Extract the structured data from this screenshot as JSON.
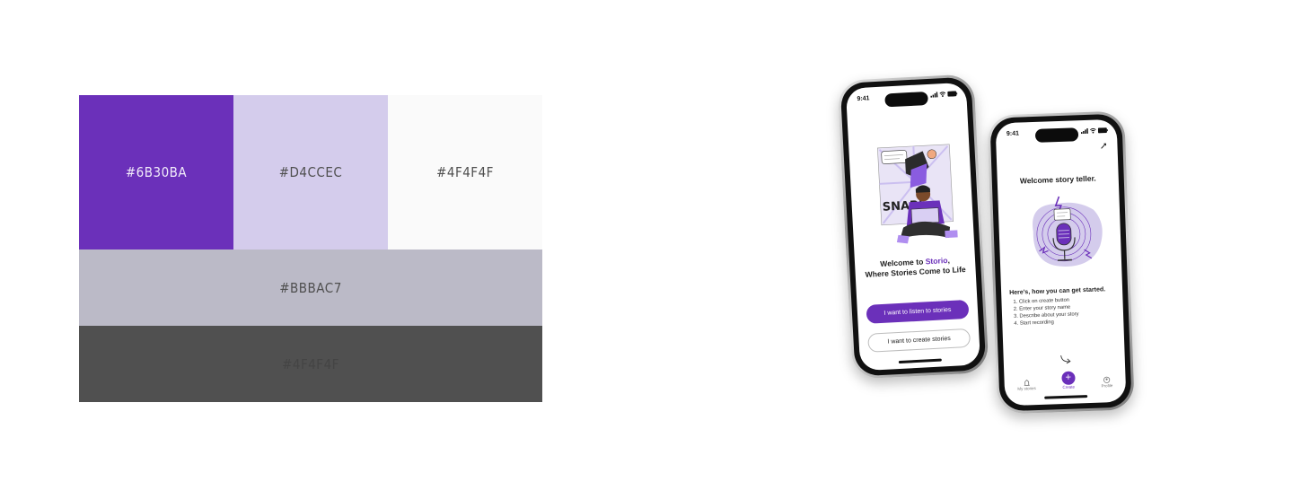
{
  "palette": {
    "swatches": [
      {
        "label": "#6B30BA",
        "color": "#6B30BA"
      },
      {
        "label": "#D4CCEC",
        "color": "#D4CCEC"
      },
      {
        "label": "#4F4F4F",
        "color": "#FAFAFA"
      },
      {
        "label": "#BBBAC7",
        "color": "#BBBAC7"
      },
      {
        "label": "#4F4F4F",
        "color": "#505050"
      }
    ]
  },
  "phone_welcome": {
    "time": "9:41",
    "welcome_prefix": "Welcome to ",
    "brand": "Storio",
    "welcome_suffix": ",",
    "welcome_line2": "Where Stories Come to Life",
    "listen_button": "I want to listen to stories",
    "create_button": "I want to create stories",
    "illustration_icon": "person-reading-comic-illustration",
    "accent_color": "#6B30BA"
  },
  "phone_create": {
    "time": "9:41",
    "title": "Welcome story teller.",
    "subtitle": "Here's, how you can get started.",
    "steps": [
      "1. Click on create button",
      "2. Enter your story name",
      "3. Describe about your story",
      "4. Start recording"
    ],
    "tabs": [
      {
        "label": "My stories",
        "icon": "stories-icon"
      },
      {
        "label": "Create",
        "icon": "plus-icon"
      },
      {
        "label": "Profile",
        "icon": "profile-icon"
      }
    ],
    "illustration_icon": "microphone-illustration"
  }
}
